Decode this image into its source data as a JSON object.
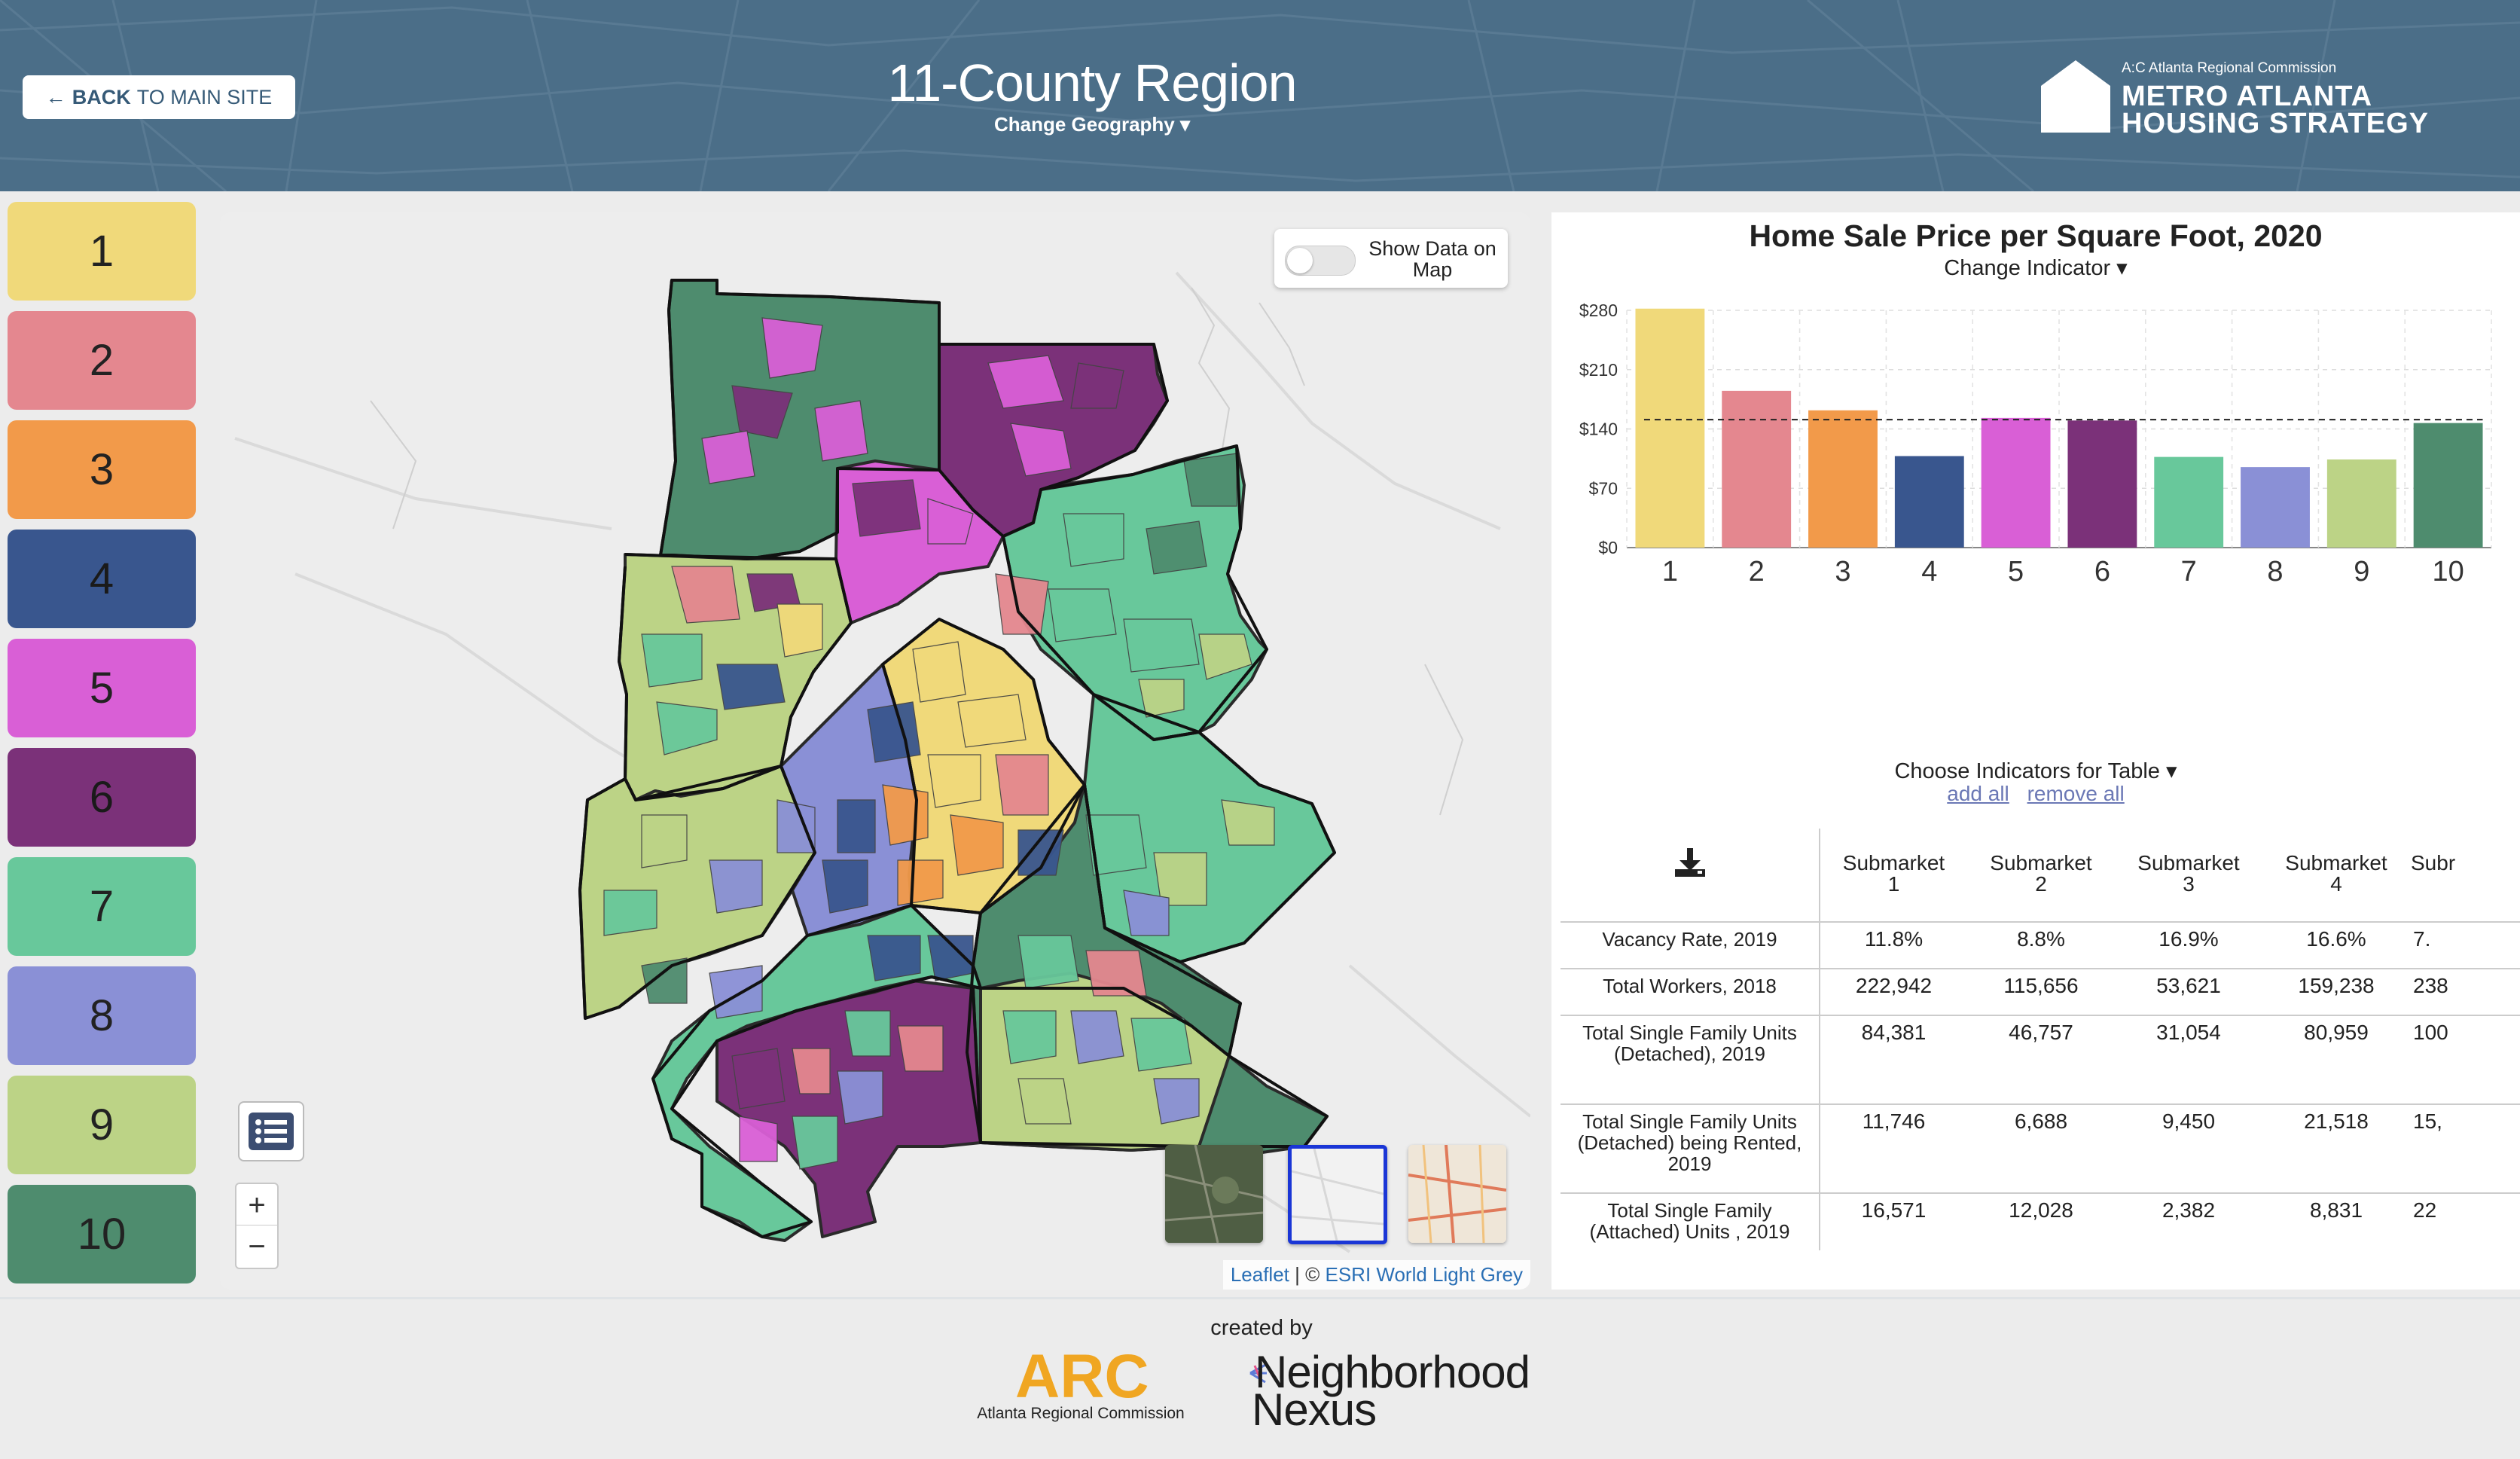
{
  "header": {
    "back_arrow": "←",
    "back_bold": "BACK",
    "back_rest": "TO MAIN SITE",
    "title": "11-County Region",
    "change_geography": "Change Geography ▾",
    "brand": {
      "arc_line": "A:C Atlanta Regional Commission",
      "line1": "METRO ATLANTA",
      "line2": "HOUSING STRATEGY"
    }
  },
  "clusters": [
    {
      "label": "1",
      "color": "#f0d97a"
    },
    {
      "label": "2",
      "color": "#e4878f"
    },
    {
      "label": "3",
      "color": "#f29a4a"
    },
    {
      "label": "4",
      "color": "#39568e"
    },
    {
      "label": "5",
      "color": "#d95fd6"
    },
    {
      "label": "6",
      "color": "#7b3179"
    },
    {
      "label": "7",
      "color": "#68c89b"
    },
    {
      "label": "8",
      "color": "#8a90d6"
    },
    {
      "label": "9",
      "color": "#bcd386"
    },
    {
      "label": "10",
      "color": "#4e8c6e"
    }
  ],
  "map": {
    "toggle_label": "Show Data on Map",
    "toggle_on": false,
    "zoom_in": "+",
    "zoom_out": "−",
    "attribution_leaflet": "Leaflet",
    "attribution_sep": " | © ",
    "attribution_esri": "ESRI World Light Grey",
    "list_icon": "list-icon",
    "selected_basemap": "light-grey"
  },
  "chart": {
    "change_indicator": "Change Indicator ▾"
  },
  "chart_data": {
    "type": "bar",
    "title": "Home Sale Price per Square Foot, 2020",
    "categories": [
      "1",
      "2",
      "3",
      "4",
      "5",
      "6",
      "7",
      "8",
      "9",
      "10"
    ],
    "values": [
      282,
      185,
      162,
      108,
      153,
      150,
      107,
      95,
      104,
      147
    ],
    "colors": [
      "#f0d97a",
      "#e4878f",
      "#f29a4a",
      "#39568e",
      "#d95fd6",
      "#7b3179",
      "#68c89b",
      "#8a90d6",
      "#bcd386",
      "#4e8c6e"
    ],
    "reference_line": 151,
    "ylim": [
      0,
      280
    ],
    "yticks": [
      "$0",
      "$70",
      "$140",
      "$210",
      "$280"
    ],
    "grid": true
  },
  "table": {
    "choose_label": "Choose Indicators for Table ▾",
    "add_all": "add all",
    "remove_all": "remove all",
    "download_icon": "download-icon",
    "columns": [
      {
        "line1": "Submarket",
        "line2": "1"
      },
      {
        "line1": "Submarket",
        "line2": "2"
      },
      {
        "line1": "Submarket",
        "line2": "3"
      },
      {
        "line1": "Submarket",
        "line2": "4"
      },
      {
        "line1": "Subr",
        "line2": ""
      }
    ],
    "rows": [
      {
        "label": "Vacancy Rate, 2019",
        "values": [
          "11.8%",
          "8.8%",
          "16.9%",
          "16.6%",
          "7."
        ]
      },
      {
        "label": "Total Workers, 2018",
        "values": [
          "222,942",
          "115,656",
          "53,621",
          "159,238",
          "238"
        ]
      },
      {
        "label": "Total Single Family Units (Detached), 2019",
        "values": [
          "84,381",
          "46,757",
          "31,054",
          "80,959",
          "100"
        ]
      },
      {
        "label": "Total Single Family Units (Detached) being Rented, 2019",
        "values": [
          "11,746",
          "6,688",
          "9,450",
          "21,518",
          "15,"
        ]
      },
      {
        "label": "Total Single Family (Attached) Units , 2019",
        "values": [
          "16,571",
          "12,028",
          "2,382",
          "8,831",
          "22"
        ]
      }
    ]
  },
  "footer": {
    "created_by": "created by",
    "arc_text": "ARC",
    "arc_caption": "Atlanta Regional Commission",
    "nn_line1": "Neighborhood",
    "nn_line2": "Nexus"
  }
}
